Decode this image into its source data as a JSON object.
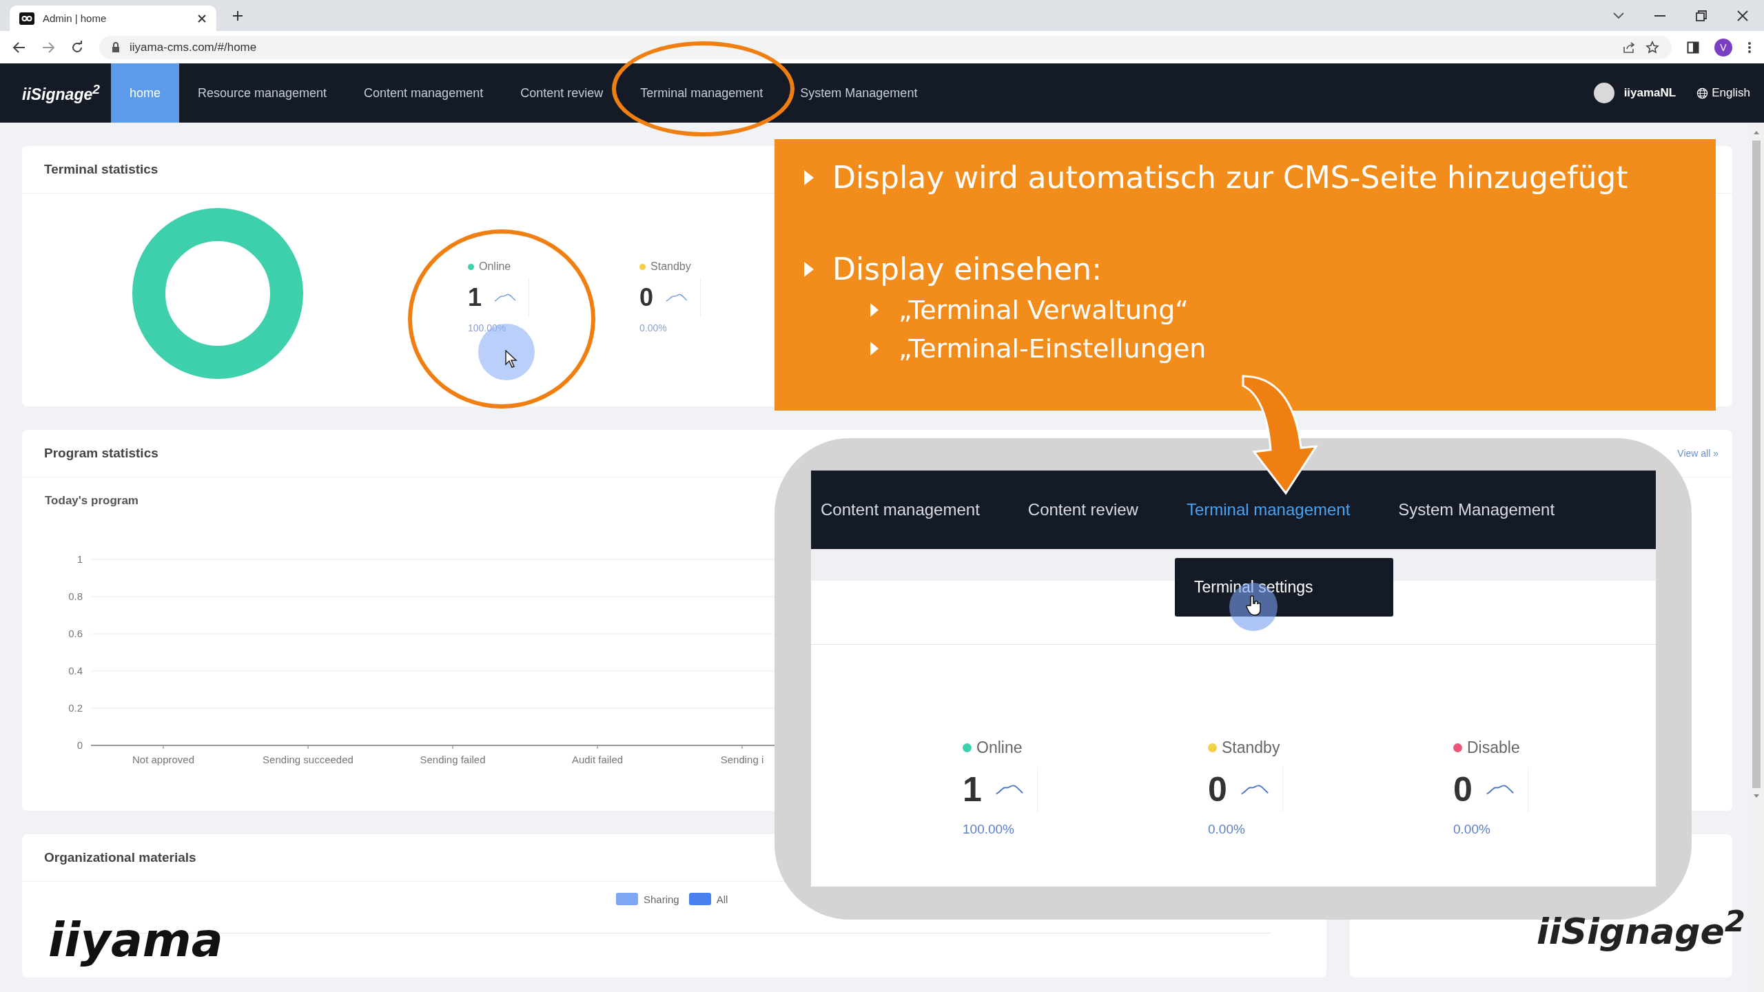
{
  "browser": {
    "tab_title": "Admin | home",
    "url": "iiyama-cms.com/#/home",
    "profile_initial": "V"
  },
  "nav": {
    "logo": "iiSignage$^{2}$",
    "items": [
      {
        "label": "home",
        "selected": true
      },
      {
        "label": "Resource management",
        "selected": false
      },
      {
        "label": "Content management",
        "selected": false
      },
      {
        "label": "Content review",
        "selected": false
      },
      {
        "label": "Terminal management",
        "selected": false
      },
      {
        "label": "System Management",
        "selected": false
      }
    ],
    "user": "iiyamaNL",
    "language": "English"
  },
  "terminal_statistics": {
    "title": "Terminal statistics",
    "stats": [
      {
        "label": "Online",
        "count": "1",
        "percent": "100.00%",
        "color": "#3ecfac"
      },
      {
        "label": "Standby",
        "count": "0",
        "percent": "0.00%",
        "color": "#f2d146"
      }
    ]
  },
  "program_statistics": {
    "title": "Program statistics",
    "view_all": "View all »",
    "subtitle": "Today's program",
    "chart_data": {
      "type": "bar",
      "categories": [
        "Not approved",
        "Sending succeeded",
        "Sending failed",
        "Audit failed",
        "Sending i"
      ],
      "values": [
        0,
        0,
        0,
        0,
        0
      ],
      "grid": true,
      "ylim": [
        0,
        1
      ],
      "yticks": [
        0,
        0.2,
        0.4,
        0.6,
        0.8,
        1
      ]
    }
  },
  "organizational_materials": {
    "title": "Organizational materials",
    "legend": [
      {
        "label": "Sharing",
        "color": "#7ea6f2"
      },
      {
        "label": "All",
        "color": "#4a7ff0"
      }
    ]
  },
  "overlay": {
    "bullets": [
      {
        "text": "Display wird automatisch zur CMS-Seite hinzugefügt"
      },
      {
        "text": "Display einsehen:",
        "children": [
          {
            "text": "„Terminal Verwaltung“"
          },
          {
            "text": "„Terminal-Einstellungen"
          }
        ]
      }
    ]
  },
  "inset": {
    "nav_items": [
      {
        "label": "Content management",
        "selected": false
      },
      {
        "label": "Content review",
        "selected": false
      },
      {
        "label": "Terminal management",
        "selected": true
      },
      {
        "label": "System Management",
        "selected": false
      }
    ],
    "dropdown_item": "Terminal settings",
    "stats": [
      {
        "label": "Online",
        "count": "1",
        "percent": "100.00%",
        "color": "#3ecfac"
      },
      {
        "label": "Standby",
        "count": "0",
        "percent": "0.00%",
        "color": "#f2d146"
      },
      {
        "label": "Disable",
        "count": "0",
        "percent": "0.00%",
        "color": "#e8567a"
      }
    ]
  },
  "logos": {
    "left": "iiyama",
    "right": "iiSignage$^{2}$"
  }
}
